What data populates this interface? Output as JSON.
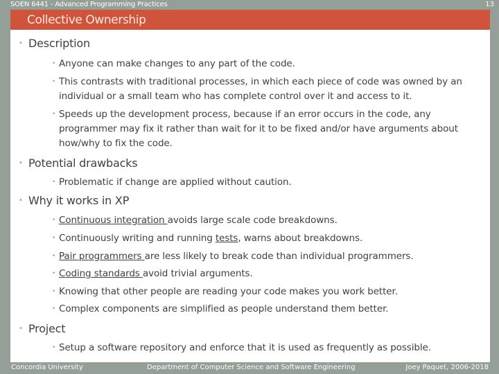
{
  "header": {
    "course": "SOEN 6441 - Advanced Programming Practices",
    "page_number": "13",
    "title": "Collective Ownership"
  },
  "colors": {
    "frame": "#939f97",
    "title_bar": "#cf543b",
    "text": "#404040",
    "bullet": "#a5a5a5"
  },
  "bullet_icon": "•",
  "sections": [
    {
      "heading": "Description",
      "items": [
        {
          "text": "Anyone can make changes to any part of the code."
        },
        {
          "text": "This contrasts with traditional processes, in which each piece of code was owned by an individual or a small team who has complete control over it and access to it."
        },
        {
          "text": "Speeds up the development process, because if an error occurs in the code, any programmer may fix it rather than wait for it to be fixed and/or have arguments about how/why to fix the code."
        }
      ]
    },
    {
      "heading": "Potential drawbacks",
      "items": [
        {
          "text": "Problematic if change are applied without caution."
        }
      ]
    },
    {
      "heading": "Why it works in XP",
      "items": [
        {
          "link": "Continuous integration ",
          "text": "avoids large scale code breakdowns."
        },
        {
          "pre": "Continuously writing and running ",
          "link": "tests",
          "text": ", warns about breakdowns."
        },
        {
          "link": "Pair programmers ",
          "text": "are less likely to break code than individual programmers."
        },
        {
          "link": "Coding standards ",
          "text": "avoid trivial arguments."
        },
        {
          "text": "Knowing that other people are reading your code makes you work better."
        },
        {
          "text": "Complex components are simplified as people understand them better."
        }
      ]
    },
    {
      "heading": "Project",
      "items": [
        {
          "text": "Setup a software repository and enforce that it is used as frequently as possible."
        }
      ]
    }
  ],
  "footer": {
    "left": "Concordia University",
    "center": "Department of Computer Science and Software Engineering",
    "right": "Joey Paquet, 2006-2018"
  }
}
